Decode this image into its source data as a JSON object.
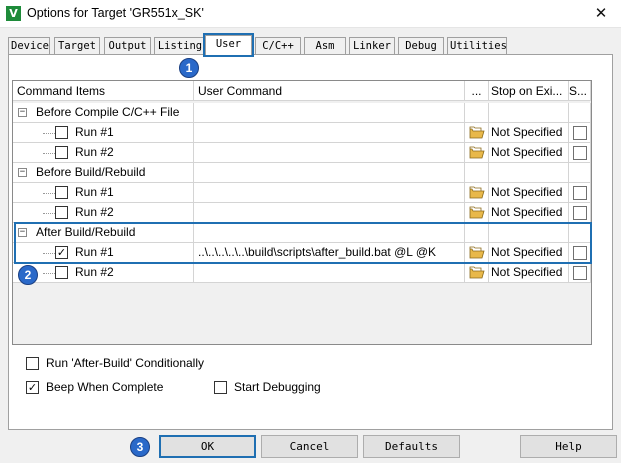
{
  "window": {
    "title": "Options for Target 'GR551x_SK'",
    "icon": "app-icon",
    "close": "✕"
  },
  "tabs": [
    {
      "label": "Device"
    },
    {
      "label": "Target"
    },
    {
      "label": "Output"
    },
    {
      "label": "Listing"
    },
    {
      "label": "User"
    },
    {
      "label": "C/C++"
    },
    {
      "label": "Asm"
    },
    {
      "label": "Linker"
    },
    {
      "label": "Debug"
    },
    {
      "label": "Utilities"
    }
  ],
  "active_tab": "User",
  "table": {
    "headers": {
      "command_items": "Command Items",
      "user_command": "User Command",
      "browse": "...",
      "stop_on_exit": "Stop on Exi...",
      "s": "S..."
    },
    "groups": [
      {
        "label": "Before Compile C/C++ File",
        "expander": "−",
        "rows": [
          {
            "label": "Run #1",
            "checked": false,
            "command": "",
            "stop": "Not Specified"
          },
          {
            "label": "Run #2",
            "checked": false,
            "command": "",
            "stop": "Not Specified"
          }
        ]
      },
      {
        "label": "Before Build/Rebuild",
        "expander": "−",
        "rows": [
          {
            "label": "Run #1",
            "checked": false,
            "command": "",
            "stop": "Not Specified"
          },
          {
            "label": "Run #2",
            "checked": false,
            "command": "",
            "stop": "Not Specified"
          }
        ]
      },
      {
        "label": "After Build/Rebuild",
        "expander": "−",
        "rows": [
          {
            "label": "Run #1",
            "checked": true,
            "command": "..\\..\\..\\..\\..\\build\\scripts\\after_build.bat @L @K",
            "stop": "Not Specified"
          },
          {
            "label": "Run #2",
            "checked": false,
            "command": "",
            "stop": "Not Specified"
          }
        ]
      }
    ]
  },
  "options": {
    "run_after_build": {
      "label": "Run 'After-Build' Conditionally",
      "checked": false
    },
    "beep_when_complete": {
      "label": "Beep When Complete",
      "checked": true
    },
    "start_debugging": {
      "label": "Start Debugging",
      "checked": false
    }
  },
  "buttons": {
    "ok": "OK",
    "cancel": "Cancel",
    "defaults": "Defaults",
    "help": "Help"
  },
  "badges": [
    "1",
    "2",
    "3"
  ],
  "colors": {
    "highlight": "#1f6fb2",
    "badge": "#2a69c9",
    "folder": "#e8b84a"
  }
}
